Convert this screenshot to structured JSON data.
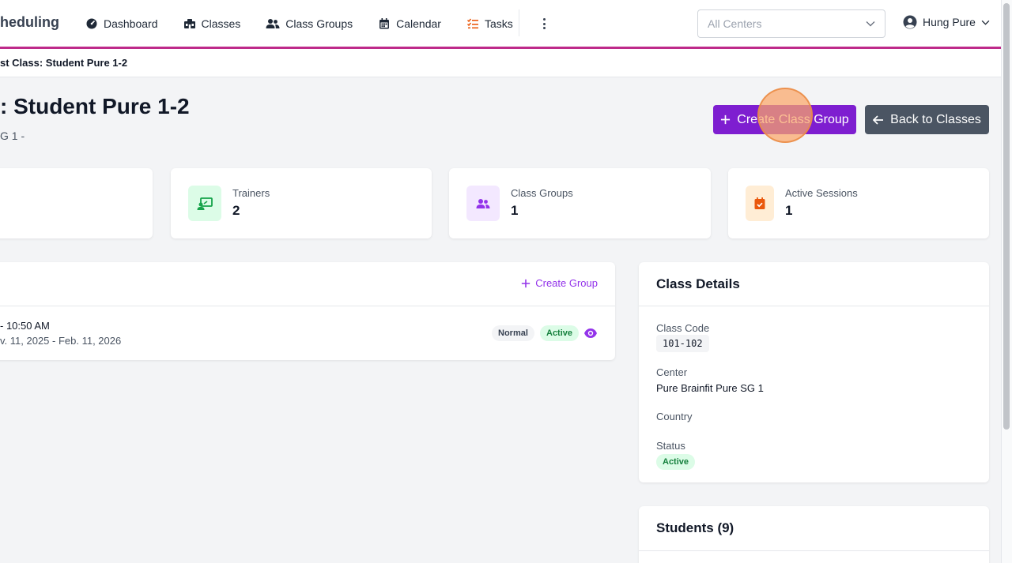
{
  "app": {
    "brand": "heduling"
  },
  "nav": {
    "items": [
      {
        "label": "Dashboard",
        "icon": "dashboard-icon"
      },
      {
        "label": "Classes",
        "icon": "classes-icon"
      },
      {
        "label": "Class Groups",
        "icon": "users-icon"
      },
      {
        "label": "Calendar",
        "icon": "calendar-icon"
      },
      {
        "label": "Tasks",
        "icon": "tasks-icon"
      }
    ],
    "more_icon": "kebab-menu-icon",
    "center_select": {
      "value": "All Centers"
    },
    "user": {
      "name": "Hung Pure"
    }
  },
  "breadcrumb": {
    "current": "st Class: Student Pure 1-2"
  },
  "header": {
    "title": ": Student Pure 1-2",
    "subtitle": "G 1 -",
    "create_button": "Create Class Group",
    "back_button": "Back to Classes"
  },
  "stats": [
    {
      "label": "Trainers",
      "value": "2",
      "icon": "trainer-icon",
      "color": "#16a34a",
      "bg": "#dcfce7"
    },
    {
      "label": "Class Groups",
      "value": "1",
      "icon": "users-icon",
      "color": "#9333ea",
      "bg": "#f3e8ff"
    },
    {
      "label": "Active Sessions",
      "value": "1",
      "icon": "calendar-check-icon",
      "color": "#ea580c",
      "bg": "#ffedd5"
    }
  ],
  "groups": {
    "create_link": "Create Group",
    "rows": [
      {
        "time": "- 10:50 AM",
        "dates": "v. 11, 2025 - Feb. 11, 2026",
        "type": "Normal",
        "status": "Active"
      }
    ]
  },
  "details": {
    "title": "Class Details",
    "class_code_label": "Class Code",
    "class_code": "101-102",
    "center_label": "Center",
    "center": "Pure Brainfit Pure SG 1",
    "country_label": "Country",
    "status_label": "Status",
    "status": "Active"
  },
  "students": {
    "title": "Students (9)"
  },
  "colors": {
    "accent": "#be2a8a",
    "primary": "#7e1ed0",
    "dark_button": "#4b5563",
    "link": "#9333ea"
  }
}
